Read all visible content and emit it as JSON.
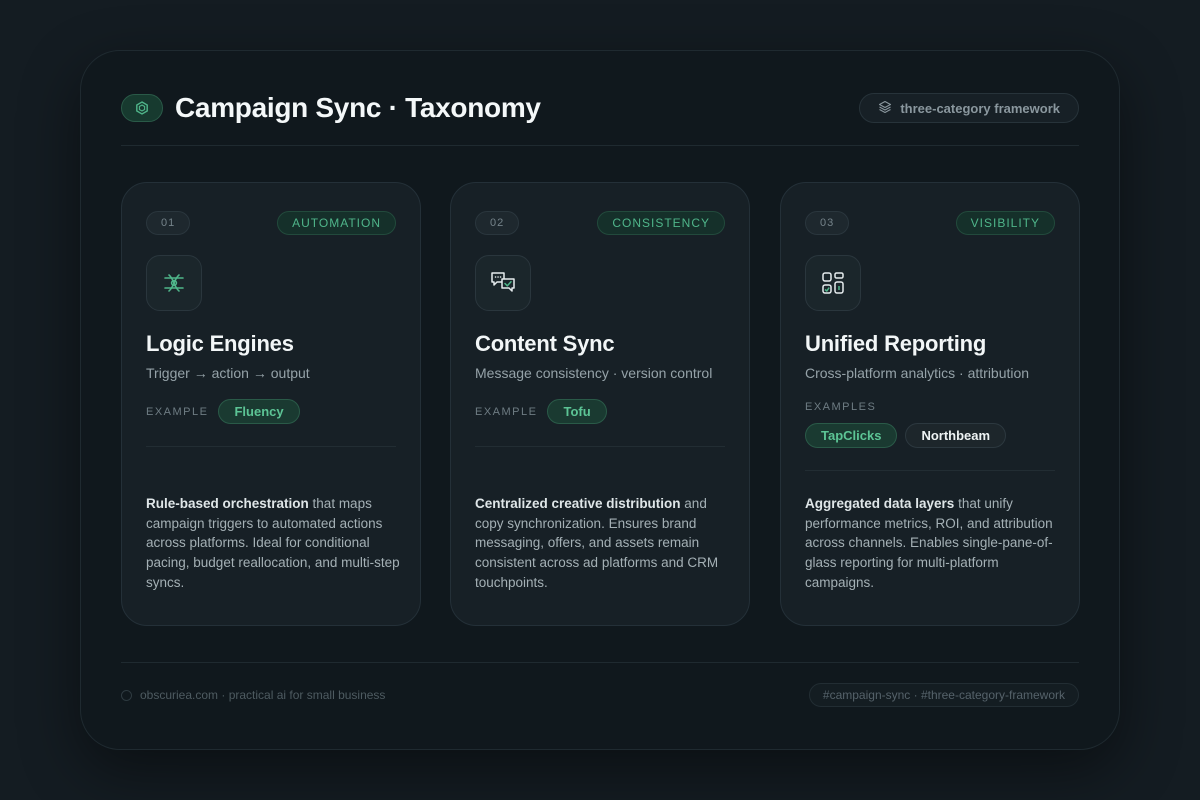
{
  "header": {
    "title": "Campaign Sync · Taxonomy",
    "badge": "three-category framework",
    "logo_icon": "hexagon-icon",
    "badge_icon": "layers-icon"
  },
  "colors": {
    "accent": "#4fb58a",
    "background": "#141c22",
    "panel": "#10181d",
    "card": "#172026"
  },
  "cards": [
    {
      "number": "01",
      "tag": "AUTOMATION",
      "icon": "logic-flow-icon",
      "title": "Logic Engines",
      "subtitle": "Trigger → action → output",
      "example_label": "EXAMPLE",
      "examples": [
        "Fluency"
      ],
      "desc_strong": "Rule-based orchestration",
      "desc_rest": " that maps campaign triggers to automated actions across platforms. Ideal for conditional pacing, budget reallocation, and multi-step syncs."
    },
    {
      "number": "02",
      "tag": "CONSISTENCY",
      "icon": "chat-sync-icon",
      "title": "Content Sync",
      "subtitle": "Message consistency · version control",
      "example_label": "EXAMPLE",
      "examples": [
        "Tofu"
      ],
      "desc_strong": "Centralized creative distribution",
      "desc_rest": " and copy synchronization. Ensures brand messaging, offers, and assets remain consistent across ad platforms and CRM touchpoints."
    },
    {
      "number": "03",
      "tag": "VISIBILITY",
      "icon": "dashboard-icon",
      "title": "Unified Reporting",
      "subtitle": "Cross-platform analytics · attribution",
      "example_label": "EXAMPLES",
      "examples": [
        "TapClicks",
        "Northbeam"
      ],
      "desc_strong": "Aggregated data layers",
      "desc_rest": " that unify performance metrics, ROI, and attribution across channels. Enables single-pane-of-glass reporting for multi-platform campaigns."
    }
  ],
  "footer": {
    "site": "obscuriea.com · practical ai for small business",
    "hashtags": "#campaign-sync · #three-category-framework"
  }
}
